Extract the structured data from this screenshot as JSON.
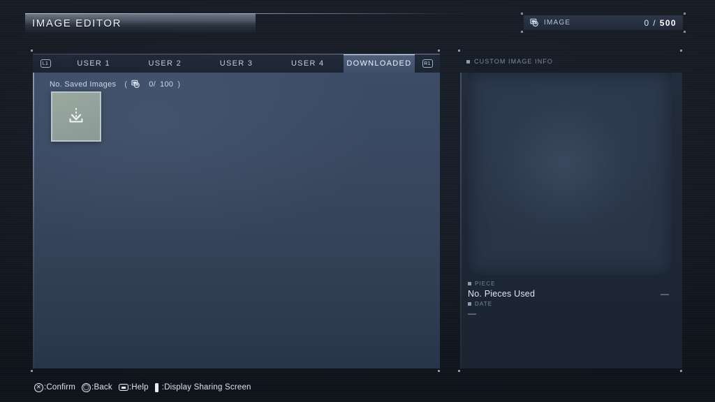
{
  "header": {
    "title": "IMAGE EDITOR",
    "counter": {
      "icon": "image-icon",
      "label": "IMAGE",
      "current": "0",
      "separator": "/",
      "max": "500"
    }
  },
  "tabs": {
    "left_shoulder": "L1",
    "right_shoulder": "R1",
    "items": [
      {
        "label": "USER 1",
        "active": false
      },
      {
        "label": "USER 2",
        "active": false
      },
      {
        "label": "USER 3",
        "active": false
      },
      {
        "label": "USER 4",
        "active": false
      },
      {
        "label": "DOWNLOADED",
        "active": true
      }
    ]
  },
  "main": {
    "saved_images_label": "No. Saved Images",
    "saved_open_paren": "(",
    "saved_icon": "image-icon",
    "saved_current": "0/",
    "saved_max": "100",
    "saved_close_paren": ")",
    "download_slot": {
      "icon": "download-icon"
    }
  },
  "side": {
    "header": "CUSTOM IMAGE INFO",
    "piece_label": "PIECE",
    "piece_name": "No. Pieces Used",
    "piece_value": "—",
    "date_label": "DATE",
    "date_value": "—"
  },
  "footer": {
    "hints": [
      {
        "glyph": "cross-button-icon",
        "text": ":Confirm"
      },
      {
        "glyph": "circle-button-icon",
        "text": ":Back"
      },
      {
        "glyph": "touchpad-button-icon",
        "text": ":Help"
      },
      {
        "glyph": "options-button-icon",
        "text": ":Display Sharing Screen"
      }
    ]
  },
  "colors": {
    "panel_top": "#3c4c66",
    "panel_bottom": "#28344a",
    "active_tab": "#47566f",
    "backdrop": "#12161e",
    "tile": "#93a29c",
    "text": "#dbe4ef"
  }
}
